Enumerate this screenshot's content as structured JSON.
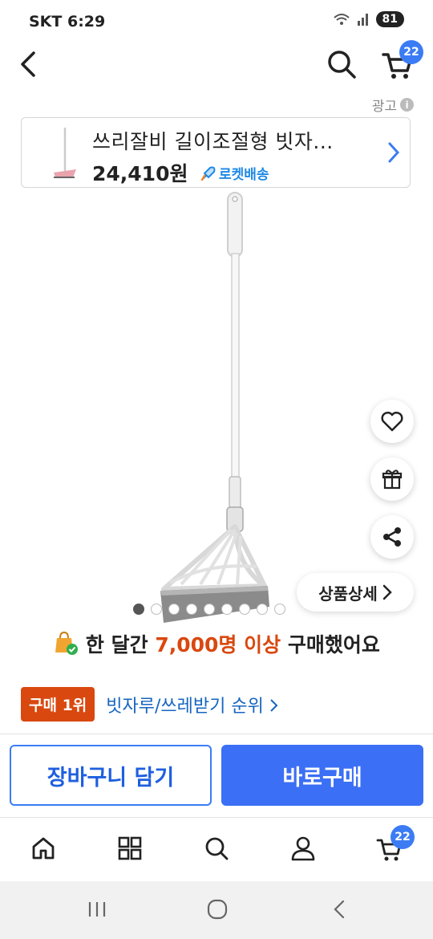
{
  "status_bar": {
    "carrier_time": "SKT 6:29",
    "battery": "81"
  },
  "top_bar": {
    "cart_count": "22"
  },
  "ad_label": "광고",
  "ad_card": {
    "title": "쓰리잘비 길이조절형 빗자...",
    "price": "24,410원",
    "delivery_badge": "로켓배송"
  },
  "product": {
    "detail_button_label": "상품상세",
    "image_count": 9,
    "active_image": 0
  },
  "purchase_stat": {
    "prefix": "한 달간",
    "highlight": "7,000명 이상",
    "suffix": "구매했어요"
  },
  "rank": {
    "tag": "구매 1위",
    "category_link": "빗자루/쓰레받기 순위"
  },
  "actions": {
    "add_to_cart": "장바구니 담기",
    "buy_now": "바로구매"
  },
  "bottom_nav": {
    "cart_count": "22"
  },
  "colors": {
    "accent_blue": "#3b6ff5",
    "rank_orange": "#d9480f",
    "rocket_blue": "#1e88e5"
  },
  "icons": [
    "back-icon",
    "search-icon",
    "cart-icon",
    "info-icon",
    "chevron-right-icon",
    "heart-icon",
    "gift-icon",
    "share-icon",
    "home-icon",
    "category-icon",
    "user-icon"
  ]
}
